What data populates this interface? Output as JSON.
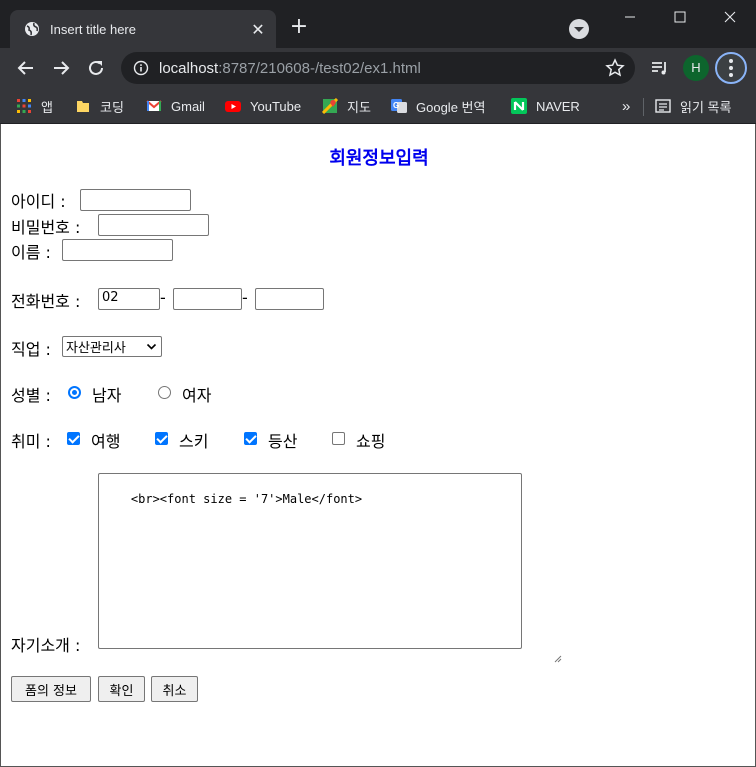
{
  "browser": {
    "tab_title": "Insert title here",
    "new_tab_symbol": "+",
    "url_host": "localhost",
    "url_path": ":8787/210608-/test02/ex1.html",
    "profile_initial": "H",
    "bookmarks": [
      {
        "label": "앱",
        "icon": "apps-icon"
      },
      {
        "label": "코딩",
        "icon": "folder-icon"
      },
      {
        "label": "Gmail",
        "icon": "gmail-icon"
      },
      {
        "label": "YouTube",
        "icon": "youtube-icon"
      },
      {
        "label": "지도",
        "icon": "maps-icon"
      },
      {
        "label": "Google 번역",
        "icon": "translate-icon"
      },
      {
        "label": "NAVER",
        "icon": "naver-icon"
      }
    ],
    "overflow_label": "»",
    "reading_list_label": "읽기 목록"
  },
  "form": {
    "heading": "회원정보입력",
    "id_label": "아이디 :",
    "password_label": "비밀번호 :",
    "name_label": "이름 :",
    "phone_label": "전화번호 :",
    "phone_first": "02",
    "phone_dash": "-",
    "job_label": "직업 :",
    "job_selected": "자산관리사",
    "gender_label": "성별 :",
    "gender_male": "남자",
    "gender_female": "여자",
    "hobby_label": "취미 :",
    "hobbies": [
      {
        "label": "여행",
        "checked": true
      },
      {
        "label": "스키",
        "checked": true
      },
      {
        "label": "등산",
        "checked": true
      },
      {
        "label": "쇼핑",
        "checked": false
      }
    ],
    "intro_label": "자기소개 :",
    "intro_value": "<br><font size = '7'>Male</font>",
    "buttons": {
      "form_info": "폼의 정보",
      "confirm": "확인",
      "cancel": "취소"
    }
  },
  "colors": {
    "heading": "#0000ee",
    "accent": "#0075ff",
    "chrome_dark": "#202124",
    "chrome_toolbar": "#35363a"
  }
}
